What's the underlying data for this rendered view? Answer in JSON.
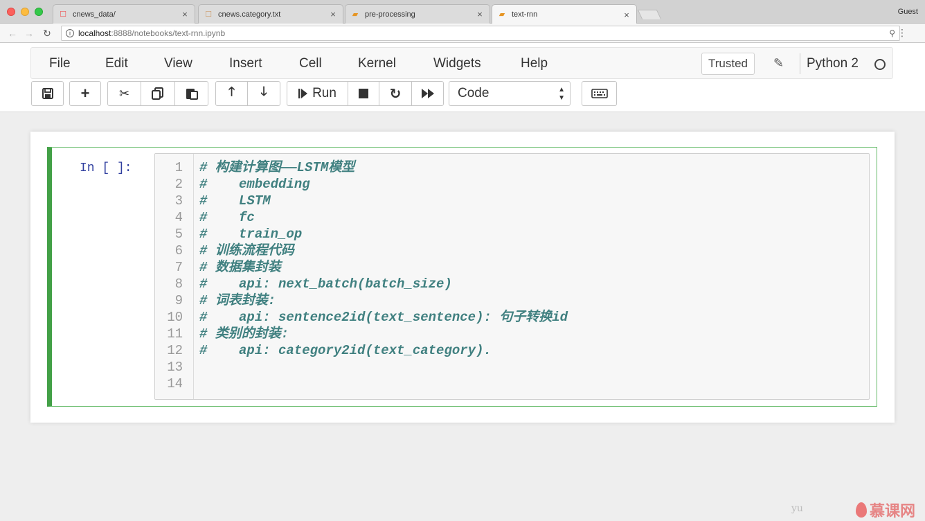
{
  "browser": {
    "tabs": [
      {
        "title": "cnews_data/",
        "close": "×",
        "favicon": "☐"
      },
      {
        "title": "cnews.category.txt",
        "close": "×",
        "favicon": "☐"
      },
      {
        "title": "pre-processing",
        "close": "×",
        "favicon": "▰"
      },
      {
        "title": "text-rnn",
        "close": "×",
        "favicon": "▰"
      }
    ],
    "profile": "Guest",
    "url_host": "localhost",
    "url_rest": ":8888/notebooks/text-rnn.ipynb"
  },
  "menubar": {
    "items": [
      "File",
      "Edit",
      "View",
      "Insert",
      "Cell",
      "Kernel",
      "Widgets",
      "Help"
    ],
    "trusted": "Trusted",
    "kernel": "Python 2"
  },
  "toolbar": {
    "run_label": "Run",
    "cell_type": "Code"
  },
  "cell": {
    "prompt": "In [ ]:",
    "lines": [
      {
        "num": "1",
        "text": "# 构建计算图——LSTM模型"
      },
      {
        "num": "2",
        "text": "#    embedding"
      },
      {
        "num": "3",
        "text": "#    LSTM"
      },
      {
        "num": "4",
        "text": "#    fc"
      },
      {
        "num": "5",
        "text": "#    train_op"
      },
      {
        "num": "6",
        "text": "# 训练流程代码"
      },
      {
        "num": "7",
        "text": "# 数据集封装"
      },
      {
        "num": "8",
        "text": "#    api: next_batch(batch_size)"
      },
      {
        "num": "9",
        "text": "# 词表封装:"
      },
      {
        "num": "10",
        "text": "#    api: sentence2id(text_sentence): 句子转换id"
      },
      {
        "num": "11",
        "text": "# 类别的封装:"
      },
      {
        "num": "12",
        "text": "#    api: category2id(text_category)."
      },
      {
        "num": "13",
        "text": ""
      },
      {
        "num": "14",
        "text": ""
      }
    ]
  },
  "watermark": {
    "author": "yu",
    "brand": "慕课网"
  },
  "colors": {
    "comment": "#408080",
    "prompt": "#303f9f",
    "cell_border": "#43a047"
  }
}
